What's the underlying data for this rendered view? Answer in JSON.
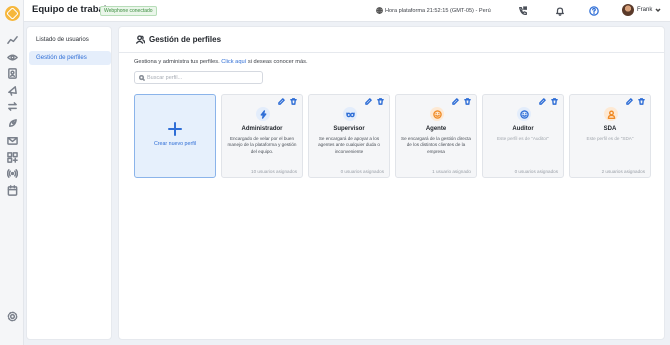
{
  "header": {
    "title": "Equipo de trabajo",
    "badge": "Webphone conectado",
    "clock": "Hora plataforma 21:52:15 (GMT-05) - Perú",
    "user_name": "Frank"
  },
  "subnav": {
    "items": [
      {
        "label": "Listado de usuarios",
        "active": false
      },
      {
        "label": "Gestión de perfiles",
        "active": true
      }
    ]
  },
  "main": {
    "title": "Gestión de perfiles",
    "description_text": "Gestiona y administra tus perfiles.",
    "description_link": "Click aquí",
    "description_tail": "si deseas conocer más.",
    "search_placeholder": "Buscar perfil...",
    "create_label": "Crear nuevo perfil",
    "cards": [
      {
        "name": "Administrador",
        "icon": "lightning-icon",
        "color": "#2f6ed6",
        "description": "Encargado de velar por el buen manejo de la plataforma y gestión del equipo.",
        "users": "10 usuarios asignados"
      },
      {
        "name": "Supervisor",
        "icon": "glasses-icon",
        "color": "#2f6ed6",
        "description": "Se encargará de apoyar a los agentes ante cualquier duda o inconveniente",
        "users": "0 usuarios asignados"
      },
      {
        "name": "Agente",
        "icon": "smile-icon",
        "color": "#f08a24",
        "description": "Se encargará de la gestión directa de los distintos clientes de la empresa",
        "users": "1 usuario asignado"
      },
      {
        "name": "Auditor",
        "icon": "smile-icon",
        "color": "#2f6ed6",
        "description": "Este perfil es de \"Auditor\"",
        "users": "0 usuarios asignados"
      },
      {
        "name": "SDA",
        "icon": "user-icon",
        "color": "#f08a24",
        "description": "Este perfil es de \"SDA\"",
        "users": "2 usuarios asignados"
      }
    ]
  },
  "colors": {
    "accent": "#2f6ed6",
    "orange": "#f08a24",
    "badge_green": "#3c8d3f"
  }
}
